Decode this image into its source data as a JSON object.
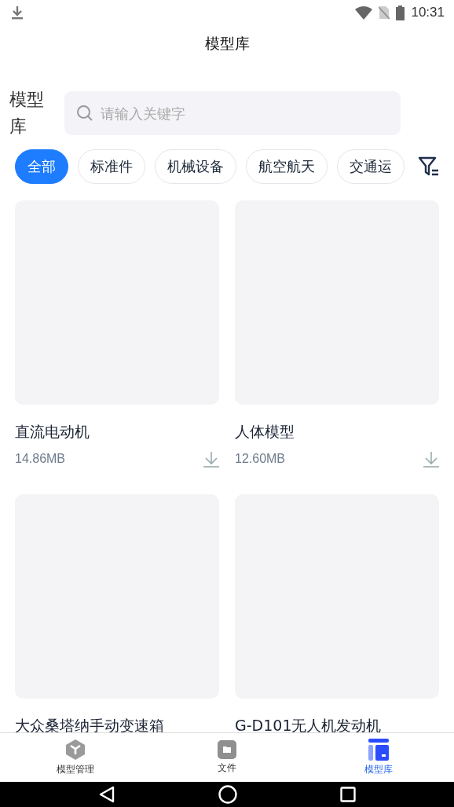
{
  "status_bar": {
    "time": "10:31"
  },
  "header": {
    "title": "模型库"
  },
  "search": {
    "label": "模型库",
    "placeholder": "请输入关键字"
  },
  "categories": [
    {
      "label": "全部",
      "selected": true
    },
    {
      "label": "标准件",
      "selected": false
    },
    {
      "label": "机械设备",
      "selected": false
    },
    {
      "label": "航空航天",
      "selected": false
    },
    {
      "label": "交通运",
      "selected": false
    }
  ],
  "models": [
    {
      "name": "直流电动机",
      "size": "14.86MB"
    },
    {
      "name": "人体模型",
      "size": "12.60MB"
    },
    {
      "name": "大众桑塔纳手动变速箱"
    },
    {
      "name": "G-D101无人机发动机"
    }
  ],
  "tab_bar": [
    {
      "label": "模型管理",
      "kind": "cube",
      "selected": false
    },
    {
      "label": "文件",
      "kind": "folder",
      "selected": false
    },
    {
      "label": "模型库",
      "kind": "library",
      "selected": true
    }
  ]
}
